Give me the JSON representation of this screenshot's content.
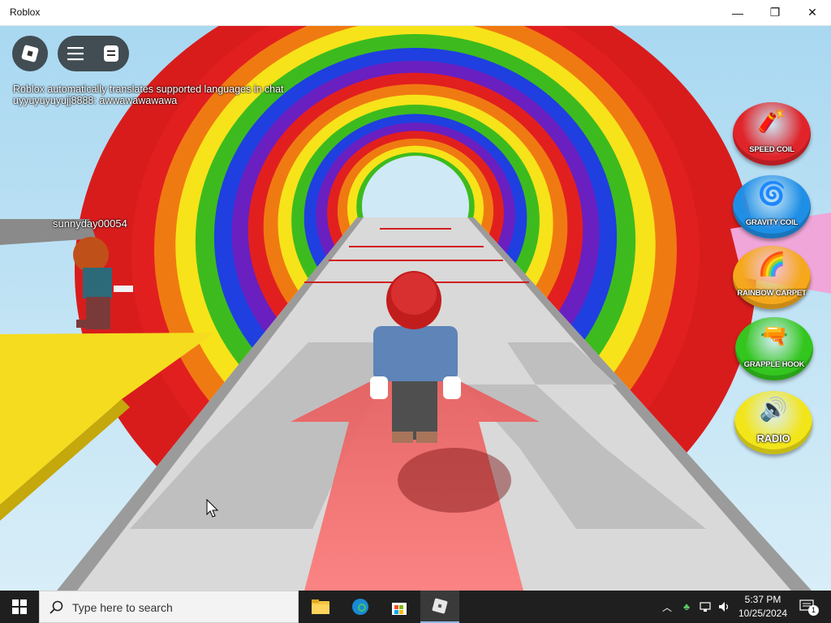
{
  "window": {
    "title": "Roblox",
    "minimize_glyph": "—",
    "maximize_glyph": "❐",
    "close_glyph": "✕"
  },
  "game": {
    "chat": {
      "system_message": "Roblox automatically translates supported languages in chat",
      "user_message": "uyyuyuyuyujj8888: awwawawawawa"
    },
    "other_player_name": "sunnyday00054",
    "buttons": [
      {
        "label": "SPEED COIL",
        "color": "#e0242a",
        "icon": "speed-coil-icon"
      },
      {
        "label": "GRAVITY COIL",
        "color": "#1f8fe6",
        "icon": "gravity-coil-icon"
      },
      {
        "label": "RAINBOW CARPET",
        "color": "#f5a81c",
        "icon": "rainbow-carpet-icon"
      },
      {
        "label": "GRAPPLE HOOK",
        "color": "#33c61e",
        "icon": "grapple-hook-icon"
      },
      {
        "label": "RADIO",
        "color": "#f2e51a",
        "icon": "radio-icon"
      }
    ]
  },
  "taskbar": {
    "search_placeholder": "Type here to search",
    "time": "5:37 PM",
    "date": "10/25/2024",
    "notification_count": "1"
  },
  "colors": {
    "rainbow": [
      "#e21f1f",
      "#f07a12",
      "#f7e31a",
      "#3dbb1e",
      "#1f3fe0",
      "#6a1fc0"
    ],
    "taskbar_bg": "#1f1f1f"
  }
}
